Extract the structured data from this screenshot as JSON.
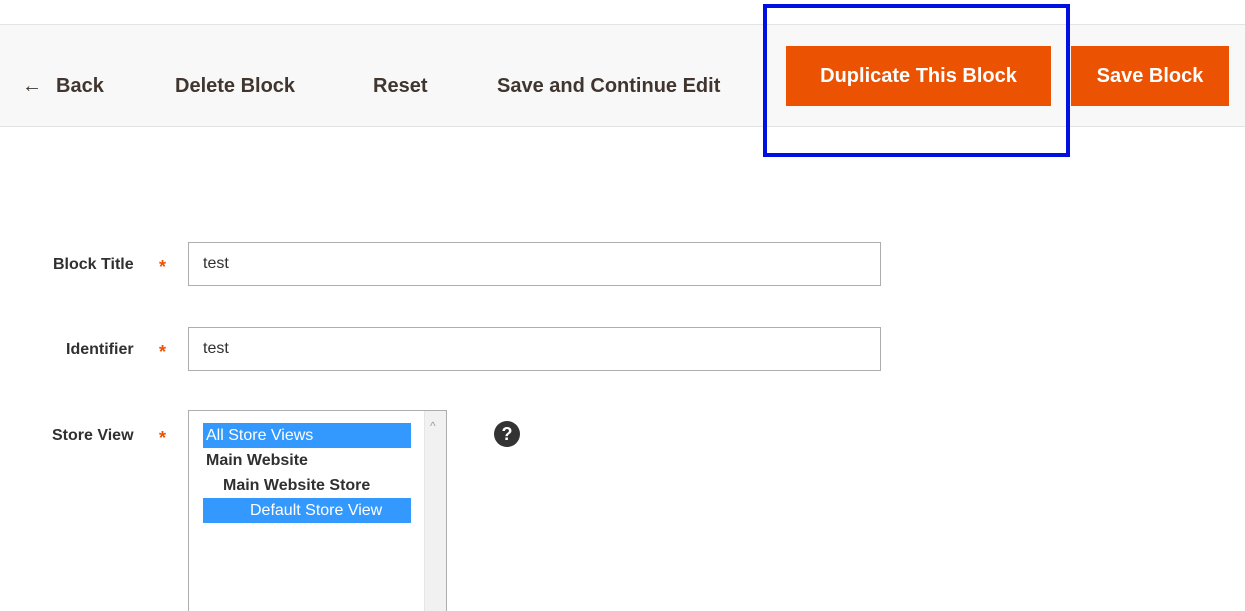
{
  "toolbar": {
    "back_icon": "left-arrow-icon",
    "back_arrow": "←",
    "back_label": "Back",
    "delete_label": "Delete Block",
    "reset_label": "Reset",
    "save_continue_label": "Save and Continue Edit",
    "duplicate_label": "Duplicate This Block",
    "save_label": "Save Block"
  },
  "form": {
    "required_mark": "*",
    "block_title": {
      "label": "Block Title",
      "value": "test"
    },
    "identifier": {
      "label": "Identifier",
      "value": "test"
    },
    "store_view": {
      "label": "Store View",
      "help_icon": "question-mark-icon",
      "help_glyph": "?",
      "options": [
        {
          "label": "All Store Views",
          "selected": true,
          "group": false
        },
        {
          "label": "Main Website",
          "selected": false,
          "group": true
        },
        {
          "label": "Main Website Store",
          "selected": false,
          "group": true
        },
        {
          "label": "Default Store View",
          "selected": true,
          "group": false
        }
      ]
    }
  },
  "colors": {
    "accent": "#eb5202",
    "highlight": "#0010e0",
    "selection": "#3399ff"
  }
}
